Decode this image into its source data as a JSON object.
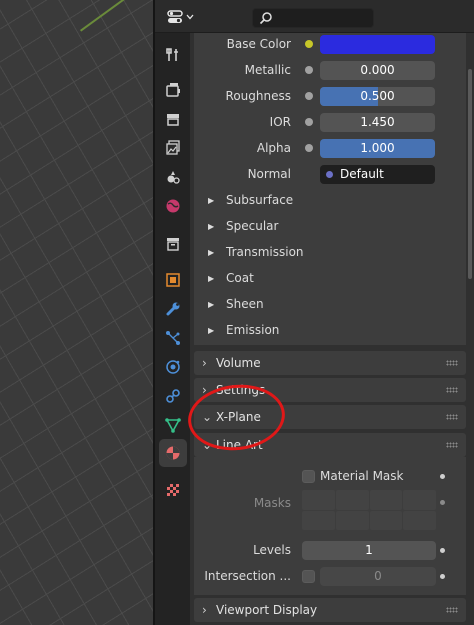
{
  "shader": {
    "base_color": {
      "label": "Base Color",
      "color": "#2b2bdf"
    },
    "metallic": {
      "label": "Metallic",
      "value": "0.000",
      "fraction": 0.0
    },
    "roughness": {
      "label": "Roughness",
      "value": "0.500",
      "fraction": 0.5
    },
    "ior": {
      "label": "IOR",
      "value": "1.450",
      "fraction": 0.0
    },
    "alpha": {
      "label": "Alpha",
      "value": "1.000",
      "fraction": 1.0
    },
    "normal": {
      "label": "Normal",
      "value": "Default"
    },
    "subpanels": [
      "Subsurface",
      "Specular",
      "Transmission",
      "Coat",
      "Sheen",
      "Emission"
    ]
  },
  "panels": {
    "volume": "Volume",
    "settings": "Settings",
    "xplane": "X-Plane",
    "lineart": "Line Art",
    "viewport_display": "Viewport Display"
  },
  "lineart": {
    "material_mask": "Material Mask",
    "masks": "Masks",
    "levels_label": "Levels",
    "levels_value": "1",
    "intersection_label": "Intersection ...",
    "intersection_value": "0"
  },
  "colors": {
    "accent": "#4772b3",
    "annotation": "#e01818",
    "socket_yellow": "#c7c729",
    "socket_gray": "#a1a1a1",
    "socket_purple": "#6b70c6"
  },
  "tabs": [
    "tool-icon",
    "render-icon",
    "output-icon",
    "view-layer-icon",
    "scene-icon",
    "world-icon",
    "collection-icon",
    "object-icon",
    "modifier-icon",
    "particles-icon",
    "physics-icon",
    "constraints-icon",
    "data-icon",
    "material-icon",
    "texture-icon"
  ]
}
